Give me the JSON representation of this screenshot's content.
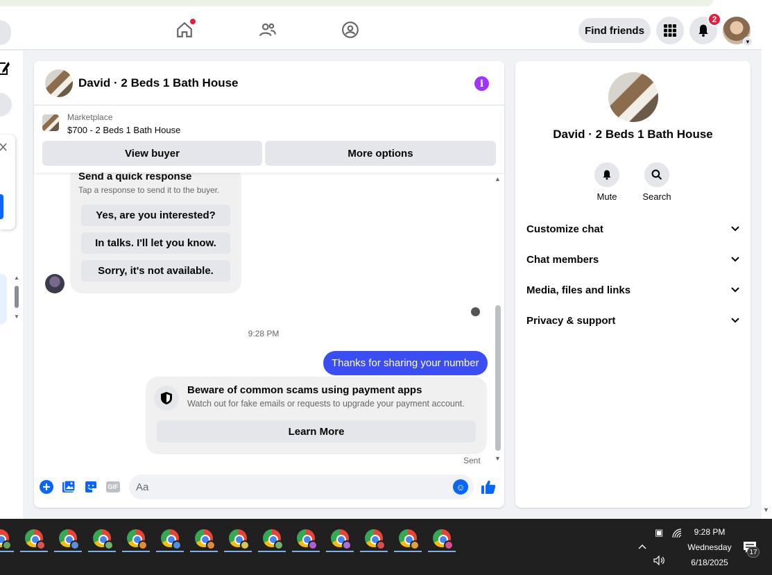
{
  "topbar": {
    "find_friends_label": "Find friends",
    "notification_count": "2"
  },
  "conversation": {
    "title": "David · 2 Beds 1 Bath House",
    "marketplace": {
      "label": "Marketplace",
      "listing": "$700 - 2 Beds 1 Bath House"
    },
    "buttons": {
      "view_buyer": "View buyer",
      "more_options": "More options"
    },
    "quick_response": {
      "title": "Send a quick response",
      "subtitle": "Tap a response to send it to the buyer.",
      "options": [
        "Yes, are you interested?",
        "In talks. I'll let you know.",
        "Sorry, it's not available."
      ]
    },
    "timestamp": "9:28 PM",
    "my_message": "Thanks for sharing your number",
    "scam_warning": {
      "title": "Beware of common scams using payment apps",
      "subtitle": "Watch out for fake emails or requests to upgrade your payment account.",
      "button": "Learn More"
    },
    "sent_label": "Sent",
    "composer": {
      "placeholder": "Aa",
      "gif_label": "GIF"
    }
  },
  "details": {
    "title": "David · 2 Beds 1 Bath House",
    "actions": [
      {
        "label": "Mute",
        "icon": "bell-icon"
      },
      {
        "label": "Search",
        "icon": "search-icon"
      }
    ],
    "sections": [
      "Customize chat",
      "Chat members",
      "Media, files and links",
      "Privacy & support"
    ]
  },
  "taskbar": {
    "time": "9:28 PM",
    "day": "Wednesday",
    "date": "6/18/2025",
    "notification_count": "17",
    "profile_colors": [
      "#5fa35f",
      "#d9534f",
      "#5b8fd9",
      "#6fb36f",
      "#e08a3c",
      "#4f8fe0",
      "#e08a3c",
      "#d9c25a",
      "#6fb36f",
      "#b05bd9",
      "#a86fd9",
      "#d94f4f",
      "#e0a13c",
      "#d94f8f"
    ]
  },
  "colors": {
    "accent": "#0866ff",
    "my_bubble": "#3b4ef4",
    "info": "#a033ff",
    "badge": "#e41e3f"
  }
}
